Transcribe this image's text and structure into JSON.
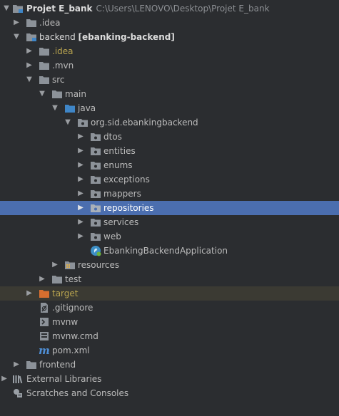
{
  "colors": {
    "background": "#2b2d30",
    "selection": "#4b6eaf",
    "excluded_row": "#3b3a33",
    "folder": "#8c9299",
    "source_folder": "#3f86c7",
    "excluded_folder": "#d66e2f",
    "ignored_text": "#b9a44f"
  },
  "tree": {
    "project": {
      "name": "Projet E_bank",
      "path": "C:\\Users\\LENOVO\\Desktop\\Projet E_bank",
      "icon": "project-folder-icon"
    },
    "idea_root": {
      "label": ".idea",
      "icon": "folder-icon"
    },
    "backend": {
      "label": "backend",
      "module": "[ebanking-backend]",
      "icon": "module-folder-icon"
    },
    "backend_idea": {
      "label": ".idea",
      "icon": "folder-icon"
    },
    "mvn": {
      "label": ".mvn",
      "icon": "folder-icon"
    },
    "src": {
      "label": "src",
      "icon": "folder-icon"
    },
    "main": {
      "label": "main",
      "icon": "folder-icon"
    },
    "java": {
      "label": "java",
      "icon": "source-folder-icon"
    },
    "package": {
      "label": "org.sid.ebankingbackend",
      "icon": "package-icon"
    },
    "subpackages": [
      {
        "label": "dtos",
        "icon": "package-icon"
      },
      {
        "label": "entities",
        "icon": "package-icon"
      },
      {
        "label": "enums",
        "icon": "package-icon"
      },
      {
        "label": "exceptions",
        "icon": "package-icon"
      },
      {
        "label": "mappers",
        "icon": "package-icon"
      },
      {
        "label": "repositories",
        "icon": "package-icon"
      },
      {
        "label": "services",
        "icon": "package-icon"
      },
      {
        "label": "web",
        "icon": "package-icon"
      }
    ],
    "app_class": {
      "label": "EbankingBackendApplication",
      "icon": "spring-boot-class-icon"
    },
    "resources": {
      "label": "resources",
      "icon": "resources-folder-icon"
    },
    "test": {
      "label": "test",
      "icon": "folder-icon"
    },
    "target": {
      "label": "target",
      "icon": "excluded-folder-icon"
    },
    "gitignore": {
      "label": ".gitignore",
      "icon": "ignore-file-icon"
    },
    "mvnw": {
      "label": "mvnw",
      "icon": "shell-script-icon"
    },
    "mvnw_cmd": {
      "label": "mvnw.cmd",
      "icon": "batch-file-icon"
    },
    "pom": {
      "label": "pom.xml",
      "icon": "maven-icon"
    },
    "frontend": {
      "label": "frontend",
      "icon": "folder-icon"
    },
    "external_libraries": {
      "label": "External Libraries",
      "icon": "libraries-icon"
    },
    "scratches": {
      "label": "Scratches and Consoles",
      "icon": "scratches-icon"
    }
  }
}
